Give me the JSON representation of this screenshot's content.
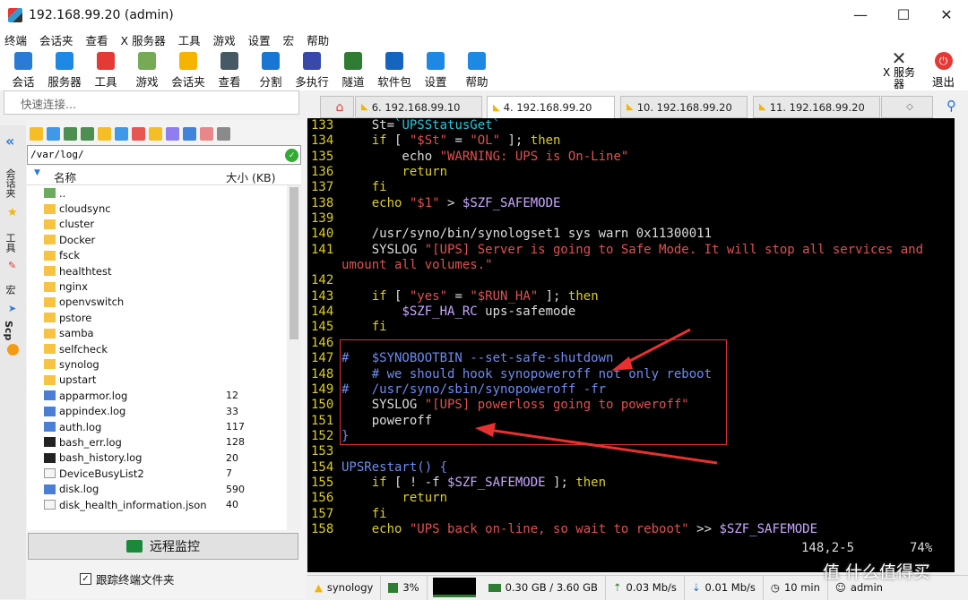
{
  "window": {
    "title": "192.168.99.20 (admin)",
    "min": "—",
    "max": "☐",
    "close": "✕"
  },
  "menu": [
    "终端",
    "会话夹",
    "查看",
    "X 服务器",
    "工具",
    "游戏",
    "设置",
    "宏",
    "帮助"
  ],
  "toolbar": [
    {
      "label": "会话",
      "color": "#2a7bd6"
    },
    {
      "label": "服务器",
      "color": "#1e88e5"
    },
    {
      "label": "工具",
      "color": "#e53935"
    },
    {
      "label": "游戏",
      "color": "#7a5"
    },
    {
      "label": "会话夹",
      "color": "#f4b400"
    },
    {
      "label": "查看",
      "color": "#455a64"
    },
    {
      "label": "分割",
      "color": "#1976d2"
    },
    {
      "label": "多执行",
      "color": "#3949ab"
    },
    {
      "label": "隧道",
      "color": "#2e7d32"
    },
    {
      "label": "软件包",
      "color": "#1565c0"
    },
    {
      "label": "设置",
      "color": "#1e88e5"
    },
    {
      "label": "帮助",
      "color": "#1e88e5"
    }
  ],
  "toolbar_right": {
    "xserver": "X 服务\n器",
    "exit": "退出"
  },
  "quick_connect": {
    "placeholder": "快速连接..."
  },
  "left_strip": {
    "sessions": "会话夹",
    "tools": "工具",
    "macros": "宏",
    "scp": "Scp"
  },
  "file_panel": {
    "path": "/var/log/",
    "header": {
      "name": "名称",
      "size": "大小 (KB)"
    },
    "files": [
      {
        "name": "..",
        "size": "",
        "type": "up"
      },
      {
        "name": "cloudsync",
        "size": "",
        "type": "folder"
      },
      {
        "name": "cluster",
        "size": "",
        "type": "folder"
      },
      {
        "name": "Docker",
        "size": "",
        "type": "folder"
      },
      {
        "name": "fsck",
        "size": "",
        "type": "folder"
      },
      {
        "name": "healthtest",
        "size": "",
        "type": "folder"
      },
      {
        "name": "nginx",
        "size": "",
        "type": "folder"
      },
      {
        "name": "openvswitch",
        "size": "",
        "type": "folder"
      },
      {
        "name": "pstore",
        "size": "",
        "type": "folder"
      },
      {
        "name": "samba",
        "size": "",
        "type": "folder"
      },
      {
        "name": "selfcheck",
        "size": "",
        "type": "folder"
      },
      {
        "name": "synolog",
        "size": "",
        "type": "folder"
      },
      {
        "name": "upstart",
        "size": "",
        "type": "folder"
      },
      {
        "name": "apparmor.log",
        "size": "12",
        "type": "log"
      },
      {
        "name": "appindex.log",
        "size": "33",
        "type": "log"
      },
      {
        "name": "auth.log",
        "size": "117",
        "type": "log"
      },
      {
        "name": "bash_err.log",
        "size": "128",
        "type": "term"
      },
      {
        "name": "bash_history.log",
        "size": "20",
        "type": "term"
      },
      {
        "name": "DeviceBusyList2",
        "size": "7",
        "type": "file"
      },
      {
        "name": "disk.log",
        "size": "590",
        "type": "log"
      },
      {
        "name": "disk_health_information.json",
        "size": "40",
        "type": "file"
      }
    ],
    "monitor_button": "远程监控",
    "follow_label": "跟踪终端文件夹"
  },
  "tabs": [
    {
      "label": "6. 192.168.99.10",
      "active": false
    },
    {
      "label": "4. 192.168.99.20",
      "active": true
    },
    {
      "label": "10. 192.168.99.20",
      "active": false
    },
    {
      "label": "11. 192.168.99.20",
      "active": false
    }
  ],
  "terminal": {
    "lines": [
      {
        "n": "133",
        "segs": [
          [
            "    St=",
            ""
          ],
          [
            "`UPSStatusGet`",
            "cyan"
          ]
        ]
      },
      {
        "n": "134",
        "segs": [
          [
            "    ",
            ""
          ],
          [
            "if",
            "kw"
          ],
          [
            " [ ",
            ""
          ],
          [
            "\"$St\"",
            "str"
          ],
          [
            " = ",
            ""
          ],
          [
            "\"OL\"",
            "str"
          ],
          [
            " ]; ",
            ""
          ],
          [
            "then",
            "kw"
          ]
        ]
      },
      {
        "n": "135",
        "segs": [
          [
            "        echo ",
            ""
          ],
          [
            "\"WARNING: UPS is On-Line\"",
            "str"
          ]
        ]
      },
      {
        "n": "136",
        "segs": [
          [
            "        ",
            ""
          ],
          [
            "return",
            "kw"
          ]
        ]
      },
      {
        "n": "137",
        "segs": [
          [
            "    ",
            ""
          ],
          [
            "fi",
            "kw"
          ]
        ]
      },
      {
        "n": "138",
        "segs": [
          [
            "    ",
            ""
          ],
          [
            "echo",
            "kw"
          ],
          [
            " ",
            ""
          ],
          [
            "\"$1\"",
            "str"
          ],
          [
            " > ",
            ""
          ],
          [
            "$SZF_SAFEMODE",
            "var"
          ]
        ]
      },
      {
        "n": "139",
        "segs": [
          [
            "",
            ""
          ]
        ]
      },
      {
        "n": "140",
        "segs": [
          [
            "    /usr/syno/bin/synologset1 sys warn 0x11300011",
            ""
          ]
        ]
      },
      {
        "n": "141",
        "segs": [
          [
            "    SYSLOG ",
            ""
          ],
          [
            "\"[UPS] Server is going to Safe Mode. It will stop all services and",
            "str"
          ]
        ]
      },
      {
        "n": "",
        "segs": [
          [
            "umount all volumes.\"",
            "str"
          ]
        ]
      },
      {
        "n": "142",
        "segs": [
          [
            "",
            ""
          ]
        ]
      },
      {
        "n": "143",
        "segs": [
          [
            "    ",
            ""
          ],
          [
            "if",
            "kw"
          ],
          [
            " [ ",
            ""
          ],
          [
            "\"yes\"",
            "str"
          ],
          [
            " = ",
            ""
          ],
          [
            "\"$RUN_HA\"",
            "str"
          ],
          [
            " ]; ",
            ""
          ],
          [
            "then",
            "kw"
          ]
        ]
      },
      {
        "n": "144",
        "segs": [
          [
            "        ",
            ""
          ],
          [
            "$SZF_HA_RC",
            "var"
          ],
          [
            " ups-safemode",
            ""
          ]
        ]
      },
      {
        "n": "145",
        "segs": [
          [
            "    ",
            ""
          ],
          [
            "fi",
            "kw"
          ]
        ]
      },
      {
        "n": "146",
        "segs": [
          [
            "",
            ""
          ]
        ]
      },
      {
        "n": "147",
        "segs": [
          [
            "# ",
            "cmt"
          ],
          [
            "  $SYNOBOOTBIN --set-safe-shutdown",
            "cmt"
          ]
        ]
      },
      {
        "n": "148",
        "segs": [
          [
            "    ",
            ""
          ],
          [
            "#",
            "cmt"
          ],
          [
            " we should hook synopoweroff not only reboot",
            "cmt"
          ]
        ]
      },
      {
        "n": "149",
        "segs": [
          [
            "#   /usr/syno/sbin/synopoweroff -fr",
            "cmt"
          ]
        ]
      },
      {
        "n": "150",
        "segs": [
          [
            "    SYSLOG ",
            ""
          ],
          [
            "\"[UPS] powerloss going to poweroff\"",
            "str"
          ]
        ]
      },
      {
        "n": "151",
        "segs": [
          [
            "    poweroff",
            ""
          ]
        ]
      },
      {
        "n": "152",
        "segs": [
          [
            "}",
            "cmt"
          ]
        ]
      },
      {
        "n": "153",
        "segs": [
          [
            "",
            ""
          ]
        ]
      },
      {
        "n": "154",
        "segs": [
          [
            "UPSRestart() {",
            "cmt"
          ]
        ]
      },
      {
        "n": "155",
        "segs": [
          [
            "    ",
            ""
          ],
          [
            "if",
            "kw"
          ],
          [
            " [ ! -f ",
            ""
          ],
          [
            "$SZF_SAFEMODE",
            "var"
          ],
          [
            " ]; ",
            ""
          ],
          [
            "then",
            "kw"
          ]
        ]
      },
      {
        "n": "156",
        "segs": [
          [
            "        ",
            ""
          ],
          [
            "return",
            "kw"
          ]
        ]
      },
      {
        "n": "157",
        "segs": [
          [
            "    ",
            ""
          ],
          [
            "fi",
            "kw"
          ]
        ]
      },
      {
        "n": "158",
        "segs": [
          [
            "    ",
            ""
          ],
          [
            "echo",
            "kw"
          ],
          [
            " ",
            ""
          ],
          [
            "\"UPS back on-line, so wait to reboot\"",
            "str"
          ],
          [
            " >> ",
            ""
          ],
          [
            "$SZF_SAFEMODE",
            "var"
          ]
        ]
      }
    ],
    "position": "148,2-5",
    "percent": "74%"
  },
  "statusbar": {
    "host": "synology",
    "cpu": "3%",
    "mem": "0.30 GB / 3.60 GB",
    "up": "0.03 Mb/s",
    "down": "0.01 Mb/s",
    "time": "10 min",
    "user": "admin"
  },
  "watermark": "值 什么值得买"
}
